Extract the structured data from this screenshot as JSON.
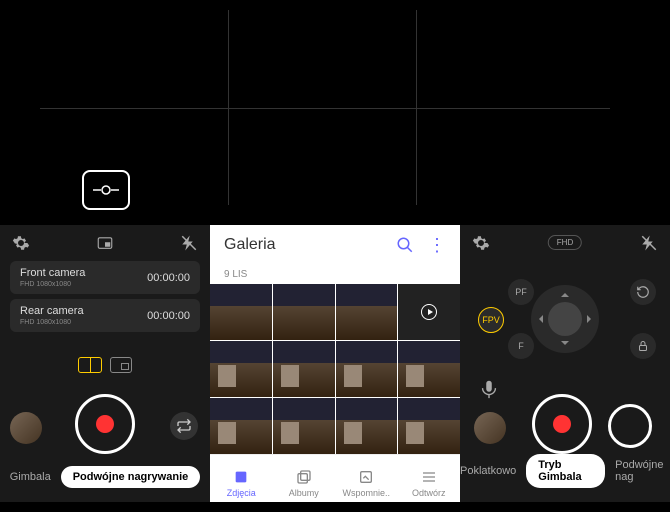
{
  "panel1": {
    "cams": [
      {
        "name": "Front camera",
        "res": "FHD 1080x1080",
        "time": "00:00:00"
      },
      {
        "name": "Rear camera",
        "res": "FHD 1080x1080",
        "time": "00:00:00"
      }
    ],
    "modes": {
      "left": "Gimbala",
      "active": "Podwójne nagrywanie"
    }
  },
  "gallery": {
    "title": "Galeria",
    "date": "9 LIS",
    "nav": [
      {
        "label": "Zdjęcia"
      },
      {
        "label": "Albumy"
      },
      {
        "label": "Wspomnie.."
      },
      {
        "label": "Odtwórz"
      }
    ]
  },
  "panel3": {
    "fhd": "FHD",
    "fpv": "FPV",
    "pf": "PF",
    "f": "F",
    "modes": {
      "left": "Poklatkowo",
      "active": "Tryb Gimbala",
      "right": "Podwójne nag"
    }
  }
}
